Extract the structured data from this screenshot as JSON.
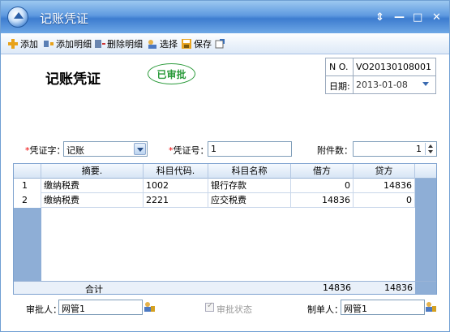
{
  "window": {
    "title": "记账凭证",
    "controls": [
      "⇕",
      "—",
      "□",
      "✕"
    ]
  },
  "toolbar": {
    "add": "添加",
    "add_detail": "添加明细",
    "delete_detail": "删除明细",
    "select": "选择",
    "save": "保存"
  },
  "voucher": {
    "title": "记账凭证",
    "stamp": "已审批",
    "no_label": "N O.",
    "no_value": "VO20130108001",
    "date_label": "日期:",
    "date_value": "2013-01-08"
  },
  "form": {
    "type_label": "凭证字：",
    "type_value": "记账",
    "number_label": "凭证号：",
    "number_value": "1",
    "attach_label": "附件数：",
    "attach_value": "1"
  },
  "grid": {
    "headers": [
      "摘要.",
      "科目代码.",
      "科目名称",
      "借方",
      "贷方"
    ],
    "rows": [
      {
        "no": "1",
        "summary": "缴纳税费",
        "code": "1002",
        "name": "银行存款",
        "debit": "0",
        "credit": "14836"
      },
      {
        "no": "2",
        "summary": "缴纳税费",
        "code": "2221",
        "name": "应交税费",
        "debit": "14836",
        "credit": "0"
      }
    ],
    "total_label": "合计",
    "total_debit": "14836",
    "total_credit": "14836"
  },
  "footer": {
    "approver_label": "审批人：",
    "approver_value": "网管1",
    "status_label": "审批状态",
    "maker_label": "制单人：",
    "maker_value": "网管1"
  }
}
